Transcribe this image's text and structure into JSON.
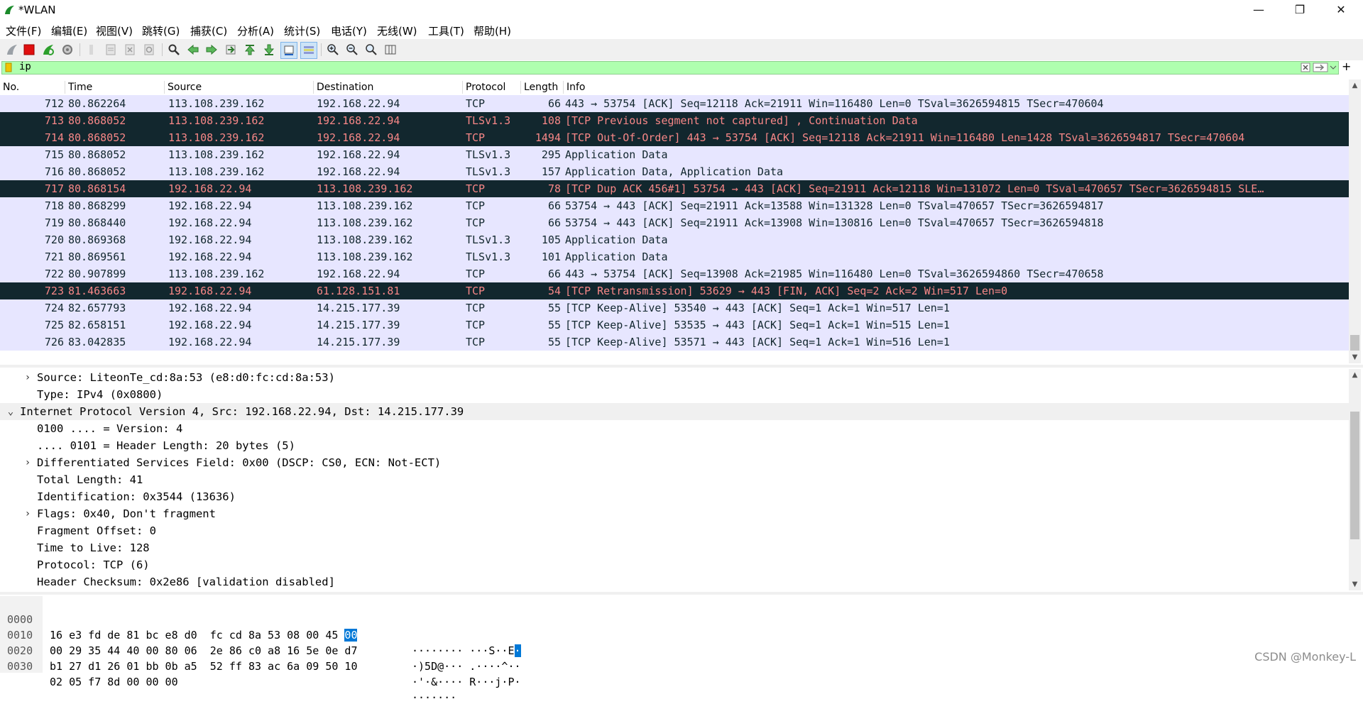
{
  "window": {
    "title": "*WLAN",
    "min_label": "—",
    "max_label": "❐",
    "close_label": "✕"
  },
  "menu": [
    "文件(F)",
    "编辑(E)",
    "视图(V)",
    "跳转(G)",
    "捕获(C)",
    "分析(A)",
    "统计(S)",
    "电话(Y)",
    "无线(W)",
    "工具(T)",
    "帮助(H)"
  ],
  "toolbar_icons": [
    "shark-fin-icon",
    "stop-capture-icon",
    "restart-capture-icon",
    "capture-options-icon",
    "open-file-icon",
    "save-file-icon",
    "close-file-icon",
    "reload-icon",
    "find-packet-icon",
    "go-back-icon",
    "go-forward-icon",
    "go-to-packet-icon",
    "go-first-icon",
    "go-last-icon",
    "autoscroll-icon",
    "colorize-icon",
    "zoom-in-icon",
    "zoom-out-icon",
    "zoom-normal-icon",
    "resize-columns-icon"
  ],
  "filter": {
    "value": "ip",
    "add_label": "+"
  },
  "columns": [
    "No.",
    "Time",
    "Source",
    "Destination",
    "Protocol",
    "Length",
    "Info"
  ],
  "packets": [
    {
      "no": "712",
      "time": "80.862264",
      "src": "113.108.239.162",
      "dst": "192.168.22.94",
      "proto": "TCP",
      "len": "66",
      "info": "443 → 53754 [ACK] Seq=12118 Ack=21911 Win=116480 Len=0 TSval=3626594815 TSecr=470604",
      "style": "normal"
    },
    {
      "no": "713",
      "time": "80.868052",
      "src": "113.108.239.162",
      "dst": "192.168.22.94",
      "proto": "TLSv1.3",
      "len": "108",
      "info": "[TCP Previous segment not captured] , Continuation Data",
      "style": "bad"
    },
    {
      "no": "714",
      "time": "80.868052",
      "src": "113.108.239.162",
      "dst": "192.168.22.94",
      "proto": "TCP",
      "len": "1494",
      "info": "[TCP Out-Of-Order] 443 → 53754 [ACK] Seq=12118 Ack=21911 Win=116480 Len=1428 TSval=3626594817 TSecr=470604",
      "style": "bad"
    },
    {
      "no": "715",
      "time": "80.868052",
      "src": "113.108.239.162",
      "dst": "192.168.22.94",
      "proto": "TLSv1.3",
      "len": "295",
      "info": "Application Data",
      "style": "normal"
    },
    {
      "no": "716",
      "time": "80.868052",
      "src": "113.108.239.162",
      "dst": "192.168.22.94",
      "proto": "TLSv1.3",
      "len": "157",
      "info": "Application Data, Application Data",
      "style": "normal"
    },
    {
      "no": "717",
      "time": "80.868154",
      "src": "192.168.22.94",
      "dst": "113.108.239.162",
      "proto": "TCP",
      "len": "78",
      "info": "[TCP Dup ACK 456#1] 53754 → 443 [ACK] Seq=21911 Ack=12118 Win=131072 Len=0 TSval=470657 TSecr=3626594815 SLE…",
      "style": "bad"
    },
    {
      "no": "718",
      "time": "80.868299",
      "src": "192.168.22.94",
      "dst": "113.108.239.162",
      "proto": "TCP",
      "len": "66",
      "info": "53754 → 443 [ACK] Seq=21911 Ack=13588 Win=131328 Len=0 TSval=470657 TSecr=3626594817",
      "style": "normal"
    },
    {
      "no": "719",
      "time": "80.868440",
      "src": "192.168.22.94",
      "dst": "113.108.239.162",
      "proto": "TCP",
      "len": "66",
      "info": "53754 → 443 [ACK] Seq=21911 Ack=13908 Win=130816 Len=0 TSval=470657 TSecr=3626594818",
      "style": "normal"
    },
    {
      "no": "720",
      "time": "80.869368",
      "src": "192.168.22.94",
      "dst": "113.108.239.162",
      "proto": "TLSv1.3",
      "len": "105",
      "info": "Application Data",
      "style": "normal"
    },
    {
      "no": "721",
      "time": "80.869561",
      "src": "192.168.22.94",
      "dst": "113.108.239.162",
      "proto": "TLSv1.3",
      "len": "101",
      "info": "Application Data",
      "style": "normal"
    },
    {
      "no": "722",
      "time": "80.907899",
      "src": "113.108.239.162",
      "dst": "192.168.22.94",
      "proto": "TCP",
      "len": "66",
      "info": "443 → 53754 [ACK] Seq=13908 Ack=21985 Win=116480 Len=0 TSval=3626594860 TSecr=470658",
      "style": "normal"
    },
    {
      "no": "723",
      "time": "81.463663",
      "src": "192.168.22.94",
      "dst": "61.128.151.81",
      "proto": "TCP",
      "len": "54",
      "info": "[TCP Retransmission] 53629 → 443 [FIN, ACK] Seq=2 Ack=2 Win=517 Len=0",
      "style": "bad"
    },
    {
      "no": "724",
      "time": "82.657793",
      "src": "192.168.22.94",
      "dst": "14.215.177.39",
      "proto": "TCP",
      "len": "55",
      "info": "[TCP Keep-Alive] 53540 → 443 [ACK] Seq=1 Ack=1 Win=517 Len=1",
      "style": "normal"
    },
    {
      "no": "725",
      "time": "82.658151",
      "src": "192.168.22.94",
      "dst": "14.215.177.39",
      "proto": "TCP",
      "len": "55",
      "info": "[TCP Keep-Alive] 53535 → 443 [ACK] Seq=1 Ack=1 Win=515 Len=1",
      "style": "normal"
    },
    {
      "no": "726",
      "time": "83.042835",
      "src": "192.168.22.94",
      "dst": "14.215.177.39",
      "proto": "TCP",
      "len": "55",
      "info": "[TCP Keep-Alive] 53571 → 443 [ACK] Seq=1 Ack=1 Win=516 Len=1",
      "style": "normal"
    }
  ],
  "details": [
    {
      "text": "Source: LiteonTe_cd:8a:53 (e8:d0:fc:cd:8a:53)",
      "level": 2,
      "exp": "›",
      "sel": false
    },
    {
      "text": "Type: IPv4 (0x0800)",
      "level": 2,
      "exp": "",
      "sel": false
    },
    {
      "text": "Internet Protocol Version 4, Src: 192.168.22.94, Dst: 14.215.177.39",
      "level": 1,
      "exp": "⌄",
      "sel": true
    },
    {
      "text": "0100 .... = Version: 4",
      "level": 2,
      "exp": "",
      "sel": false
    },
    {
      "text": ".... 0101 = Header Length: 20 bytes (5)",
      "level": 2,
      "exp": "",
      "sel": false
    },
    {
      "text": "Differentiated Services Field: 0x00 (DSCP: CS0, ECN: Not-ECT)",
      "level": 2,
      "exp": "›",
      "sel": false
    },
    {
      "text": "Total Length: 41",
      "level": 2,
      "exp": "",
      "sel": false
    },
    {
      "text": "Identification: 0x3544 (13636)",
      "level": 2,
      "exp": "",
      "sel": false
    },
    {
      "text": "Flags: 0x40, Don't fragment",
      "level": 2,
      "exp": "›",
      "sel": false
    },
    {
      "text": "Fragment Offset: 0",
      "level": 2,
      "exp": "",
      "sel": false
    },
    {
      "text": "Time to Live: 128",
      "level": 2,
      "exp": "",
      "sel": false
    },
    {
      "text": "Protocol: TCP (6)",
      "level": 2,
      "exp": "",
      "sel": false
    },
    {
      "text": "Header Checksum: 0x2e86 [validation disabled]",
      "level": 2,
      "exp": "",
      "sel": false
    }
  ],
  "bytes": [
    {
      "offset": "0000",
      "hex_a": "16 e3 fd de 81 bc e8 d0  fc cd 8a 53 08 00 45 ",
      "hex_hl": "00",
      "ascii_a": "········ ···S··E",
      "ascii_hl": "·"
    },
    {
      "offset": "0010",
      "hex_a": "00 29 35 44 40 00 80 06  2e 86 c0 a8 16 5e 0e d7",
      "hex_hl": "",
      "ascii_a": "·)5D@··· .····^··",
      "ascii_hl": ""
    },
    {
      "offset": "0020",
      "hex_a": "b1 27 d1 26 01 bb 0b a5  52 ff 83 ac 6a 09 50 10",
      "hex_hl": "",
      "ascii_a": "·'·&···· R···j·P·",
      "ascii_hl": ""
    },
    {
      "offset": "0030",
      "hex_a": "02 05 f7 8d 00 00 00",
      "hex_hl": "",
      "ascii_a": "·······",
      "ascii_hl": ""
    }
  ],
  "watermark": "CSDN @Monkey-L",
  "colors": {
    "normal_bg": "#e7e6ff",
    "normal_fg": "#12272e",
    "bad_bg": "#12272e",
    "bad_fg": "#f78787",
    "filter_bg": "#afffaf"
  }
}
